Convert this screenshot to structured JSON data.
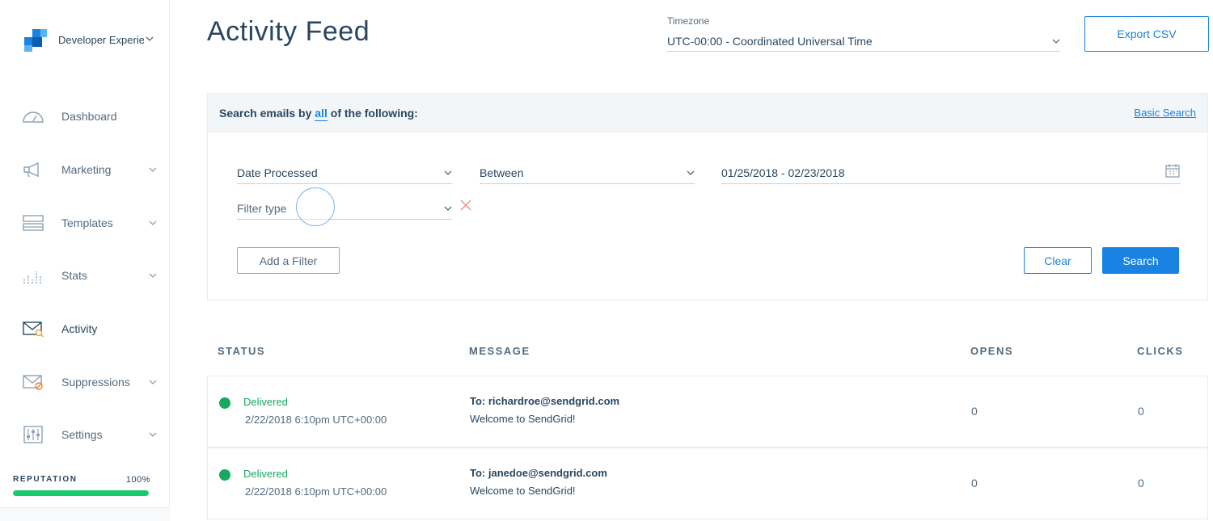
{
  "account": {
    "name": "Developer Experience"
  },
  "sidebar": {
    "items": [
      {
        "label": "Dashboard",
        "icon": "dashboard-gauge-icon",
        "has_submenu": false
      },
      {
        "label": "Marketing",
        "icon": "megaphone-icon",
        "has_submenu": true
      },
      {
        "label": "Templates",
        "icon": "templates-icon",
        "has_submenu": true
      },
      {
        "label": "Stats",
        "icon": "bar-chart-icon",
        "has_submenu": true
      },
      {
        "label": "Activity",
        "icon": "activity-mail-search-icon",
        "has_submenu": false,
        "active": true
      },
      {
        "label": "Suppressions",
        "icon": "mail-blocked-icon",
        "has_submenu": true
      },
      {
        "label": "Settings",
        "icon": "settings-sliders-icon",
        "has_submenu": true
      }
    ],
    "reputation": {
      "label": "REPUTATION",
      "value_text": "100%",
      "fraction": 1.0
    }
  },
  "header": {
    "title": "Activity Feed",
    "timezone_label": "Timezone",
    "timezone_value": "UTC-00:00 - Coordinated Universal Time",
    "export_label": "Export CSV"
  },
  "search": {
    "heading_pre": "Search emails by",
    "heading_all": "all",
    "heading_post": "of the following:",
    "basic_search_label": "Basic Search",
    "filter1_field": "Date Processed",
    "filter1_operator": "Between",
    "filter1_value": "01/25/2018 - 02/23/2018",
    "filter2_placeholder": "Filter type",
    "add_filter_label": "Add a Filter",
    "clear_label": "Clear",
    "search_label": "Search"
  },
  "table": {
    "columns": [
      "STATUS",
      "MESSAGE",
      "OPENS",
      "CLICKS"
    ],
    "rows": [
      {
        "status": "Delivered",
        "time": "2/22/2018 6:10pm UTC+00:00",
        "to": "To: richardroe@sendgrid.com",
        "subject": "Welcome to SendGrid!",
        "opens": "0",
        "clicks": "0"
      },
      {
        "status": "Delivered",
        "time": "2/22/2018 6:10pm UTC+00:00",
        "to": "To: janedoe@sendgrid.com",
        "subject": "Welcome to SendGrid!",
        "opens": "0",
        "clicks": "0"
      }
    ]
  },
  "colors": {
    "accent": "#1a82e2",
    "success": "#18a860",
    "text": "#294661",
    "muted": "#546b81"
  }
}
